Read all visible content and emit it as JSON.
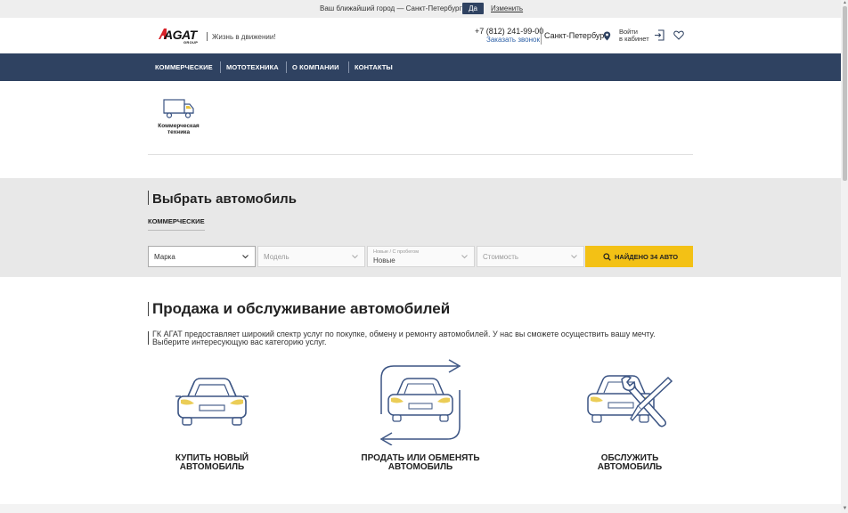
{
  "city_bar": {
    "question": "Ваш ближайший город — Санкт-Петербург?",
    "yes_label": "Да",
    "change_label": "Изменить"
  },
  "header": {
    "logo_text": "AGAT",
    "logo_sub": "GROUP",
    "slogan": "Жизнь в движении!",
    "phone": "+7 (812) 241-99-00",
    "callback": "Заказать звонок",
    "city": "Санкт-Петербург",
    "login_line1": "Войти",
    "login_line2": "в кабинет"
  },
  "nav": {
    "items": [
      "КОММЕРЧЕСКИЕ",
      "МОТОТЕХНИКА",
      "О КОМПАНИИ",
      "КОНТАКТЫ"
    ]
  },
  "categories": {
    "items": [
      {
        "label": "Коммерческая техника",
        "icon": "truck-icon"
      }
    ]
  },
  "choose": {
    "title": "Выбрать автомобиль",
    "tab": "КОММЕРЧЕСКИЕ",
    "brand_placeholder": "Марка",
    "model_placeholder": "Модель",
    "condition_label": "Новые / С пробегом",
    "condition_value": "Новые",
    "price_placeholder": "Стоимость",
    "find_button": "НАЙДЕНО 34 АВТО"
  },
  "sales": {
    "title": "Продажа и обслуживание автомобилей",
    "description": "ГК АГАТ предоставляет широкий спектр услуг по покупке, обмену и ремонту автомобилей. У нас вы сможете осуществить вашу мечту. Выберите интересующую вас категорию услуг.",
    "services": [
      {
        "label_line1": "КУПИТЬ НОВЫЙ",
        "label_line2": "АВТОМОБИЛЬ",
        "icon": "car-icon"
      },
      {
        "label_line1": "ПРОДАТЬ ИЛИ ОБМЕНЯТЬ",
        "label_line2": "АВТОМОБИЛЬ",
        "icon": "car-exchange-icon"
      },
      {
        "label_line1": "ОБСЛУЖИТЬ",
        "label_line2": "АВТОМОБИЛЬ",
        "icon": "car-service-icon"
      }
    ]
  },
  "colors": {
    "nav_bg": "#2f4261",
    "accent_yellow": "#f3c115",
    "icon_blue": "#3b5483",
    "headlight_yellow": "#e8c43a"
  }
}
